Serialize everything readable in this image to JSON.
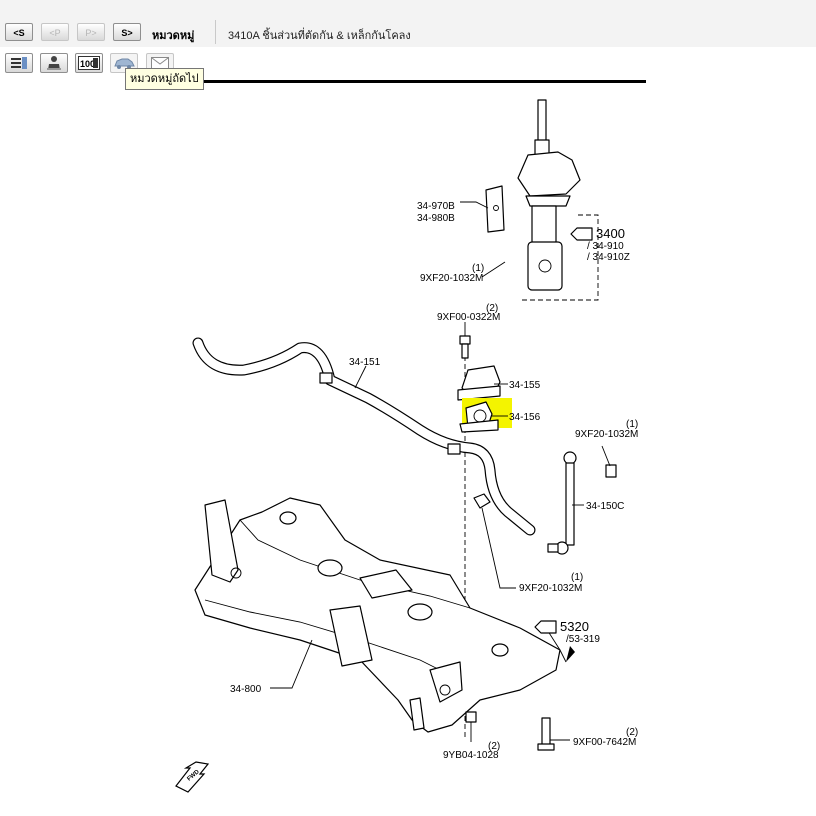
{
  "nav": {
    "prev_cat": "<S",
    "prev_page": "<P",
    "next_page": "P>",
    "next_cat": "S>"
  },
  "category_label": "หมวดหมู่",
  "page_title": "3410A  ชิ้นส่วนที่ตัดกัน & เหล็กกันโคลง",
  "tooltip": "หมวดหมู่ถัดไป",
  "toolbar": {
    "quantity_badge": "100"
  },
  "diagram": {
    "bracket_code_1": "34-970B",
    "bracket_code_2": "34-980B",
    "bolt_qty_top": "(1)",
    "bolt_code_top": "9XF20-1032M",
    "strut_ref": "3400",
    "strut_ref_sub1": "/ 34-910",
    "strut_ref_sub2": "/ 34-910Z",
    "bolt_qty_2": "(2)",
    "bolt_code_2": "9XF00-0322M",
    "stabilizer_code": "34-151",
    "bracket_code_3": "34-155",
    "bushing_code": "34-156",
    "nut_qty_right": "(1)",
    "nut_code_right": "9XF20-1032M",
    "link_code": "34-150C",
    "nut_qty_mid": "(1)",
    "nut_code_mid": "9XF20-1032M",
    "section_ref": "5320",
    "section_ref_sub": "/53-319",
    "crossmember_code": "34-800",
    "bolt_qty_bottom_right": "(2)",
    "bolt_code_bottom_right": "9XF00-7642M",
    "bolt_qty_bottom": "(2)",
    "bolt_code_bottom": "9YB04-1028",
    "fwd_text": "FWD"
  },
  "colors": {
    "highlight": "#f4f400",
    "tooltip_bg": "#ffffe1",
    "topbar_bg": "#f3f3f3"
  }
}
